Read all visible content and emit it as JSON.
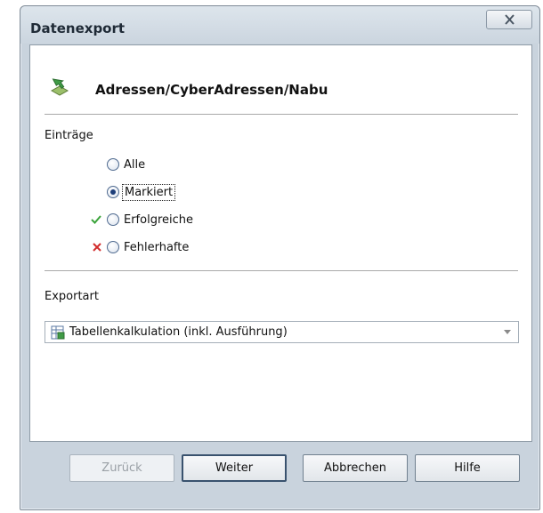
{
  "window": {
    "title": "Datenexport"
  },
  "header": {
    "path": "Adressen/CyberAdressen/Nabu",
    "icon": "export-arrow-icon"
  },
  "entries": {
    "label": "Einträge",
    "options": [
      {
        "label": "Alle",
        "selected": false,
        "marker": null
      },
      {
        "label": "Markiert",
        "selected": true,
        "marker": null
      },
      {
        "label": "Erfolgreiche",
        "selected": false,
        "marker": "check-icon"
      },
      {
        "label": "Fehlerhafte",
        "selected": false,
        "marker": "cross-icon"
      }
    ]
  },
  "export_type": {
    "label": "Exportart",
    "selected": "Tabellenkalkulation (inkl. Ausführung)",
    "icon": "spreadsheet-icon"
  },
  "buttons": {
    "back": "Zurück",
    "next": "Weiter",
    "cancel": "Abbrechen",
    "help": "Hilfe"
  },
  "colors": {
    "check": "#3aa33a",
    "cross": "#d22c2c",
    "window_frame": "#c9d3dd"
  }
}
